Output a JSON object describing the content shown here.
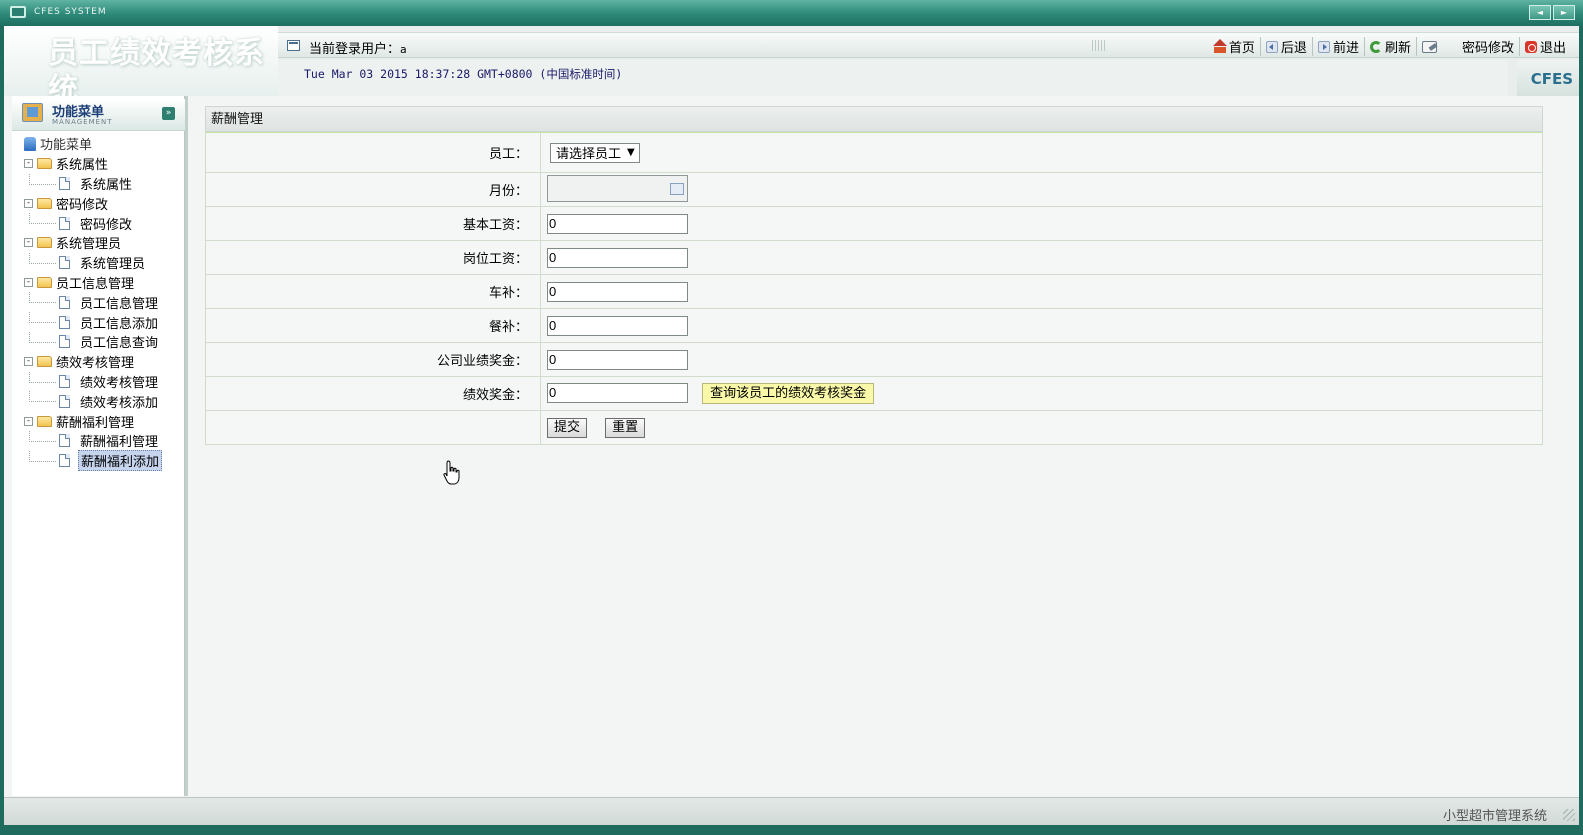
{
  "window": {
    "title": "CFES SYSTEM",
    "btn_prev": "◄",
    "btn_next": "►"
  },
  "header": {
    "system_title": "员工绩效考核系统",
    "user_label": "当前登录用户：",
    "user_name": "a",
    "datetime": "Tue Mar 03 2015 18:37:28 GMT+0800 (中国标准时间)",
    "brand": "CFES",
    "toolbar": {
      "home": "首页",
      "back": "后退",
      "forward": "前进",
      "refresh": "刷新",
      "change_password": "密码修改",
      "logout": "退出"
    }
  },
  "sidebar": {
    "title": "功能菜单",
    "subtitle": "MANAGEMENT",
    "root_label": "功能菜单",
    "groups": [
      {
        "label": "系统属性",
        "items": [
          "系统属性"
        ]
      },
      {
        "label": "密码修改",
        "items": [
          "密码修改"
        ]
      },
      {
        "label": "系统管理员",
        "items": [
          "系统管理员"
        ]
      },
      {
        "label": "员工信息管理",
        "items": [
          "员工信息管理",
          "员工信息添加",
          "员工信息查询"
        ]
      },
      {
        "label": "绩效考核管理",
        "items": [
          "绩效考核管理",
          "绩效考核添加"
        ]
      },
      {
        "label": "薪酬福利管理",
        "items": [
          "薪酬福利管理",
          "薪酬福利添加"
        ]
      }
    ],
    "active_item": "薪酬福利添加"
  },
  "main": {
    "panel_title": "薪酬管理",
    "form": {
      "employee_label": "员工：",
      "employee_selected": "请选择员工",
      "month_label": "月份：",
      "month_value": "",
      "base_salary_label": "基本工资：",
      "base_salary_value": "0",
      "post_salary_label": "岗位工资：",
      "post_salary_value": "0",
      "car_allowance_label": "车补：",
      "car_allowance_value": "0",
      "meal_allowance_label": "餐补：",
      "meal_allowance_value": "0",
      "company_bonus_label": "公司业绩奖金：",
      "company_bonus_value": "0",
      "performance_bonus_label": "绩效奖金：",
      "performance_bonus_value": "0",
      "query_bonus_button": "查询该员工的绩效考核奖金",
      "submit_button": "提交",
      "reset_button": "重置"
    }
  },
  "statusbar": {
    "text": "小型超市管理系统"
  }
}
